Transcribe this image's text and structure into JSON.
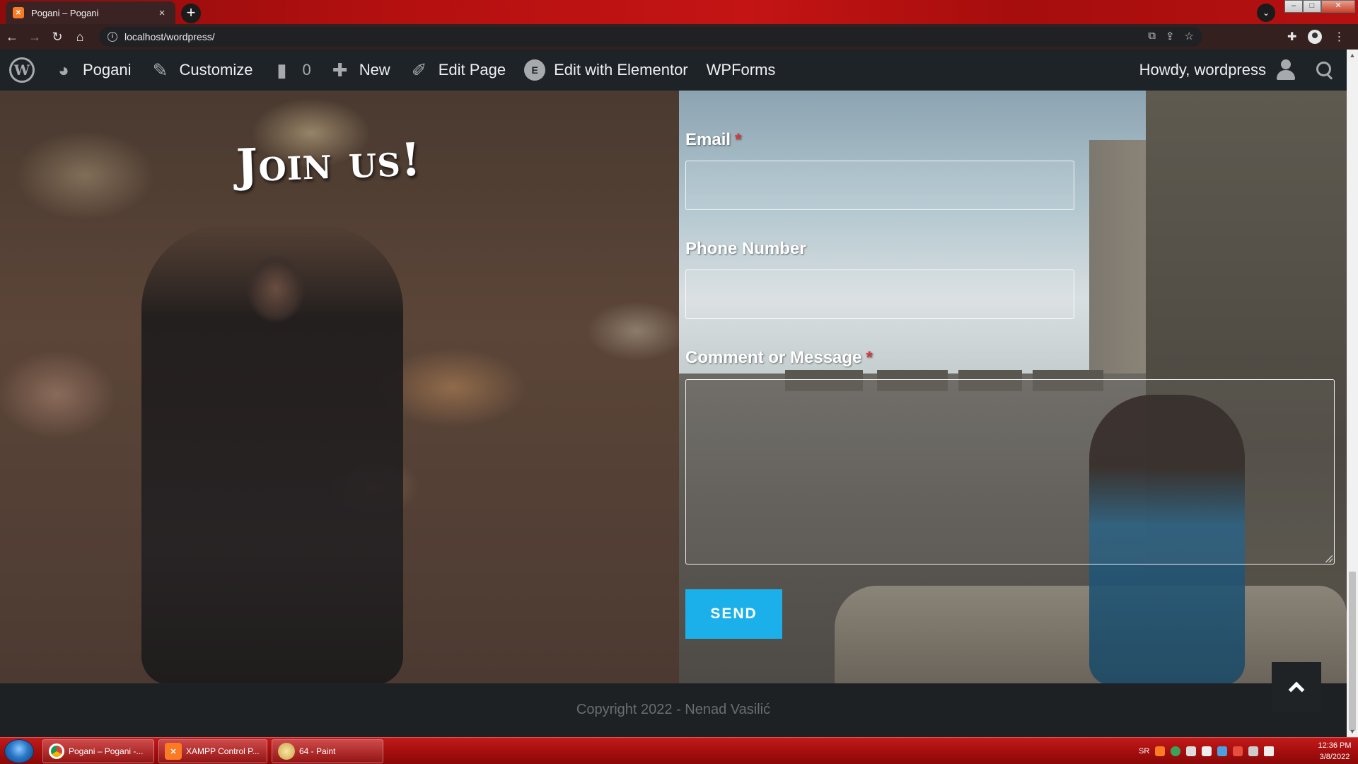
{
  "browser": {
    "tab_title": "Pogani – Pogani",
    "tab_favicon": "xampp-icon",
    "new_tab_label": "+",
    "url": "localhost/wordpress/"
  },
  "adminbar": {
    "site_name": "Pogani",
    "customize": "Customize",
    "comments_count": "0",
    "new": "New",
    "edit_page": "Edit Page",
    "edit_elementor": "Edit with Elementor",
    "wpforms": "WPForms",
    "howdy": "Howdy, wordpress"
  },
  "page": {
    "heading": "Join us!",
    "form": {
      "email_label": "Email",
      "phone_label": "Phone Number",
      "message_label": "Comment or Message",
      "required_mark": "*",
      "send_label": "SEND"
    },
    "footer_text": "Copyright 2022 - Nenad Vasilić"
  },
  "taskbar": {
    "tasks": [
      {
        "label": "Pogani – Pogani -...",
        "icon": "chrome-icon"
      },
      {
        "label": "XAMPP Control P...",
        "icon": "xampp-icon"
      },
      {
        "label": "64 - Paint",
        "icon": "paint-icon"
      }
    ],
    "language": "SR",
    "time": "12:36 PM",
    "date": "3/8/2022"
  },
  "colors": {
    "send_button": "#1cb0ea",
    "required": "#d63638",
    "adminbar_bg": "#1d2327"
  }
}
